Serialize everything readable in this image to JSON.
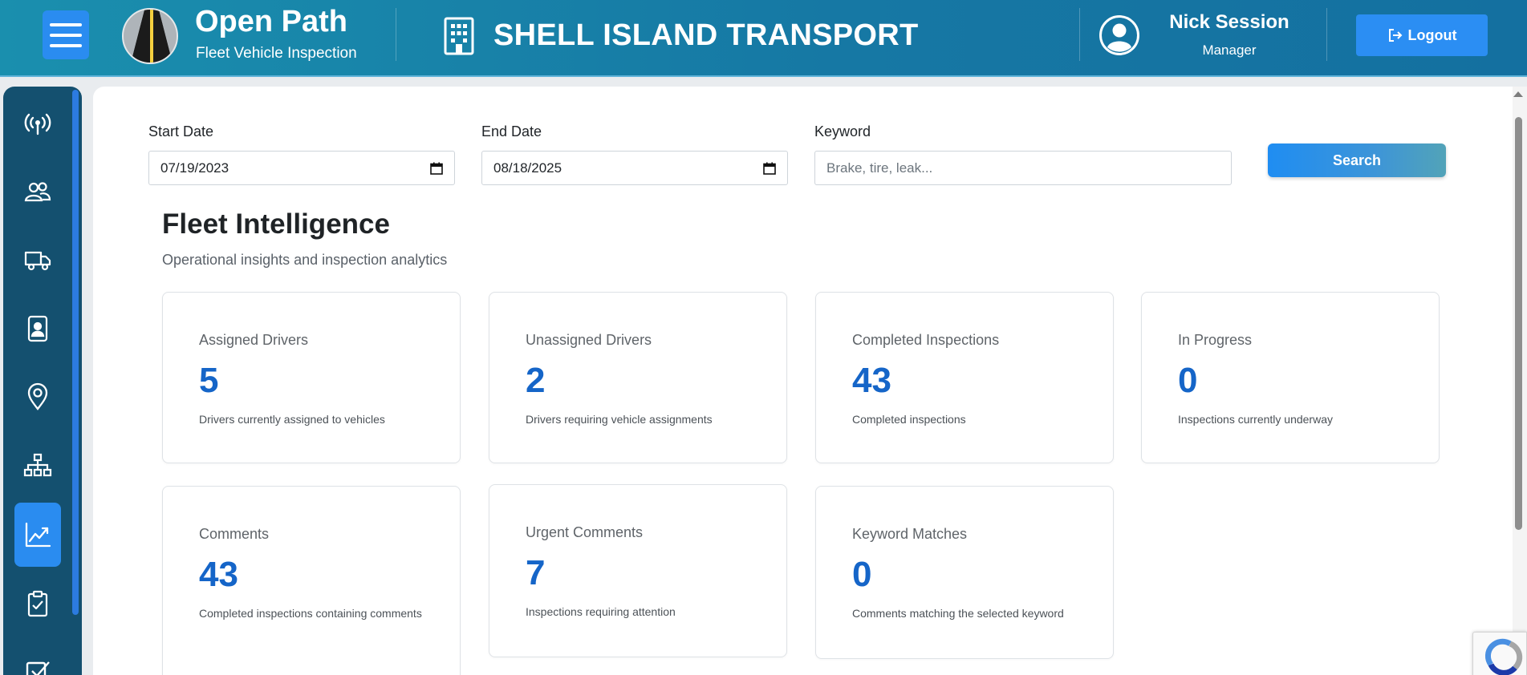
{
  "header": {
    "brand_title": "Open Path",
    "brand_subtitle": "Fleet Vehicle Inspection",
    "company_name": "SHELL ISLAND TRANSPORT",
    "user_name": "Nick Session",
    "user_role": "Manager",
    "logout_label": "Logout"
  },
  "sidebar": {
    "items": [
      {
        "icon": "broadcast-icon",
        "active": false
      },
      {
        "icon": "users-icon",
        "active": false
      },
      {
        "icon": "truck-icon",
        "active": false
      },
      {
        "icon": "id-badge-icon",
        "active": false
      },
      {
        "icon": "location-pin-icon",
        "active": false
      },
      {
        "icon": "org-chart-icon",
        "active": false
      },
      {
        "icon": "graph-up-icon",
        "active": true
      },
      {
        "icon": "clipboard-check-icon",
        "active": false
      },
      {
        "icon": "checkbox-icon",
        "active": false
      }
    ]
  },
  "filters": {
    "start_label": "Start Date",
    "start_value": "07/19/2023",
    "end_label": "End Date",
    "end_value": "08/18/2025",
    "keyword_label": "Keyword",
    "keyword_placeholder": "Brake, tire, leak...",
    "keyword_value": "",
    "search_label": "Search"
  },
  "section": {
    "title": "Fleet Intelligence",
    "subtitle": "Operational insights and inspection analytics"
  },
  "cards": [
    {
      "label": "Assigned Drivers",
      "value": "5",
      "desc": "Drivers currently assigned to vehicles"
    },
    {
      "label": "Unassigned Drivers",
      "value": "2",
      "desc": "Drivers requiring vehicle assignments"
    },
    {
      "label": "Completed Inspections",
      "value": "43",
      "desc": "Completed inspections"
    },
    {
      "label": "In Progress",
      "value": "0",
      "desc": "Inspections currently underway"
    },
    {
      "label": "Comments",
      "value": "43",
      "desc": "Completed inspections containing comments"
    },
    {
      "label": "Urgent Comments",
      "value": "7",
      "desc": "Inspections requiring attention"
    },
    {
      "label": "Keyword Matches",
      "value": "0",
      "desc": "Comments matching the selected keyword"
    }
  ],
  "colors": {
    "header_gradient_start": "#1a8fae",
    "header_gradient_end": "#1470a0",
    "accent": "#2a8cf0",
    "sidebar_bg": "#14506f",
    "card_value": "#1565c8"
  }
}
